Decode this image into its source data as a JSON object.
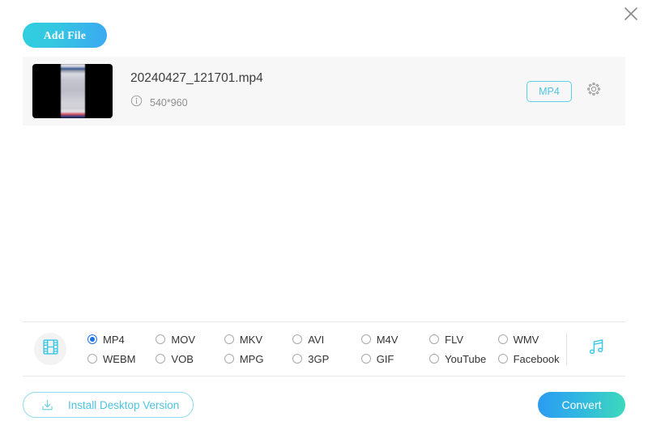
{
  "window": {
    "close_label": "close-icon"
  },
  "toolbar": {
    "add_file_label": "Add File"
  },
  "file": {
    "name": "20240427_121701.mp4",
    "dimensions": "540*960",
    "info_icon": "info-icon",
    "thumbnail_icon": "video-thumbnail",
    "output_format_badge": "MP4",
    "settings_icon": "gear-icon"
  },
  "format_panel": {
    "video_icon": "film-strip-icon",
    "audio_icon": "music-note-icon",
    "selected": "MP4",
    "options": [
      {
        "label": "MP4",
        "selected": true
      },
      {
        "label": "MOV",
        "selected": false
      },
      {
        "label": "MKV",
        "selected": false
      },
      {
        "label": "AVI",
        "selected": false
      },
      {
        "label": "M4V",
        "selected": false
      },
      {
        "label": "FLV",
        "selected": false
      },
      {
        "label": "WMV",
        "selected": false
      },
      {
        "label": "WEBM",
        "selected": false
      },
      {
        "label": "VOB",
        "selected": false
      },
      {
        "label": "MPG",
        "selected": false
      },
      {
        "label": "3GP",
        "selected": false
      },
      {
        "label": "GIF",
        "selected": false
      },
      {
        "label": "YouTube",
        "selected": false
      },
      {
        "label": "Facebook",
        "selected": false
      }
    ]
  },
  "footer": {
    "install_label": "Install Desktop Version",
    "install_icon": "download-icon",
    "convert_label": "Convert"
  },
  "colors": {
    "accent_cyan": "#4ec3e0",
    "accent_blue": "#2b9bf2",
    "accent_teal": "#3dd9bb",
    "radio_selected": "#1a73e8",
    "row_background": "#f7f7f7"
  }
}
